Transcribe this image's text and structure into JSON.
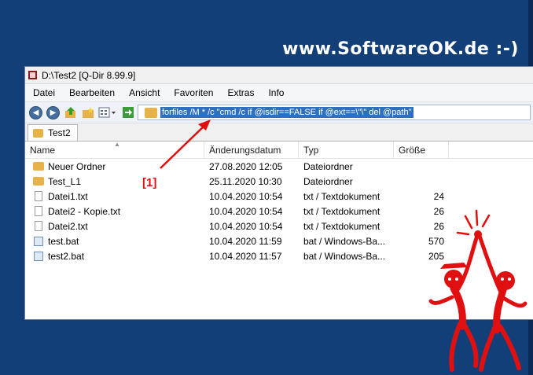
{
  "watermark": "www.SoftwareOK.de :-)",
  "window": {
    "title": "D:\\Test2  [Q-Dir 8.99.9]"
  },
  "menu": [
    "Datei",
    "Bearbeiten",
    "Ansicht",
    "Favoriten",
    "Extras",
    "Info"
  ],
  "address": {
    "value": "forfiles /M * /c \"cmd /c if @isdir==FALSE if @ext==\\\"\\\" del @path\""
  },
  "tab": {
    "label": "Test2"
  },
  "columns": {
    "name": "Name",
    "date": "Änderungsdatum",
    "type": "Typ",
    "size": "Größe"
  },
  "files": [
    {
      "name": "Neuer Ordner",
      "date": "27.08.2020 12:05",
      "type": "Dateiordner",
      "size": "",
      "icon": "folder-icon"
    },
    {
      "name": "Test_L1",
      "date": "25.11.2020 10:30",
      "type": "Dateiordner",
      "size": "",
      "icon": "folder-icon"
    },
    {
      "name": "Datei1.txt",
      "date": "10.04.2020 10:54",
      "type": "txt / Textdokument",
      "size": "24",
      "icon": "text-file-icon"
    },
    {
      "name": "Datei2 - Kopie.txt",
      "date": "10.04.2020 10:54",
      "type": "txt / Textdokument",
      "size": "26",
      "icon": "text-file-icon"
    },
    {
      "name": "Datei2.txt",
      "date": "10.04.2020 10:54",
      "type": "txt / Textdokument",
      "size": "26",
      "icon": "text-file-icon"
    },
    {
      "name": "test.bat",
      "date": "10.04.2020 11:59",
      "type": "bat / Windows-Ba...",
      "size": "570",
      "icon": "batch-file-icon"
    },
    {
      "name": "test2.bat",
      "date": "10.04.2020 11:57",
      "type": "bat / Windows-Ba...",
      "size": "205",
      "icon": "batch-file-icon"
    }
  ],
  "annotation": "[1]",
  "colors": {
    "background": "#123f78",
    "accent_red": "#e01010",
    "selection": "#2f6fbf"
  }
}
